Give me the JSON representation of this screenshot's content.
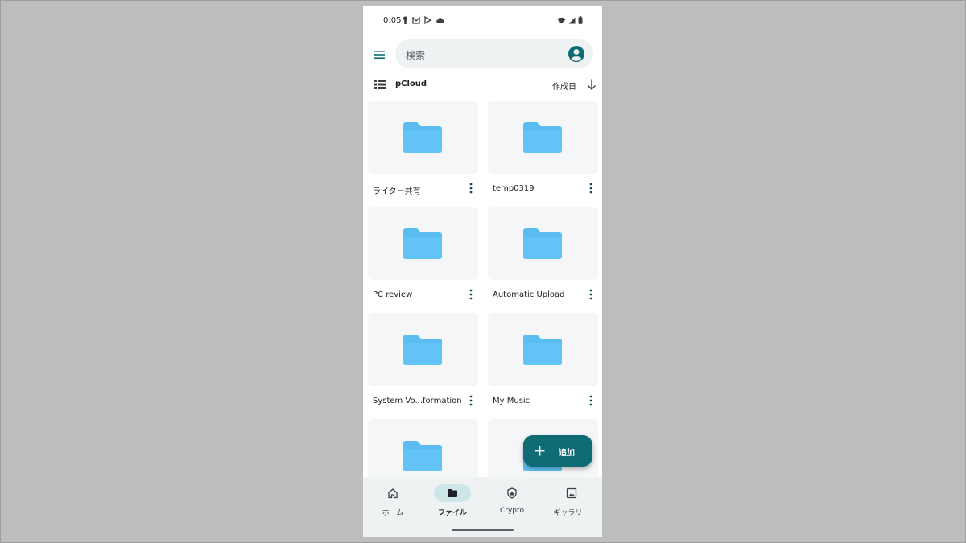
{
  "status_bar": {
    "time": "0:05",
    "left_icons": [
      "keyhole-icon",
      "gmail-icon",
      "play-store-icon",
      "cloud-icon"
    ],
    "right_icons": [
      "wifi-icon",
      "signal-icon",
      "battery-icon"
    ]
  },
  "app_bar": {
    "search_placeholder": "検索",
    "menu_icon": "hamburger-menu-icon",
    "account_icon": "account-circle-icon"
  },
  "list_header": {
    "folder_title": "pCloud",
    "sort_label": "作成日",
    "sort_direction_icon": "arrow-down-icon",
    "view_icon": "list-view-icon"
  },
  "folders": [
    {
      "name": "ライター共有"
    },
    {
      "name": "temp0319"
    },
    {
      "name": "PC review"
    },
    {
      "name": "Automatic Upload"
    },
    {
      "name": "System Vo...formation"
    },
    {
      "name": "My Music"
    },
    {
      "name": ""
    },
    {
      "name": ""
    }
  ],
  "fab": {
    "label": "追加",
    "icon": "plus-icon"
  },
  "bottom_nav": {
    "items": [
      {
        "label": "ホーム",
        "icon": "home-icon",
        "active": false
      },
      {
        "label": "ファイル",
        "icon": "folder-icon",
        "active": true
      },
      {
        "label": "Crypto",
        "icon": "shield-icon",
        "active": false
      },
      {
        "label": "ギャラリー",
        "icon": "gallery-icon",
        "active": false
      }
    ]
  },
  "colors": {
    "accent": "#0f6b74",
    "folder": "#5bbcf2",
    "nav_background": "#eef2f3",
    "active_pill": "#cfe6e9"
  }
}
